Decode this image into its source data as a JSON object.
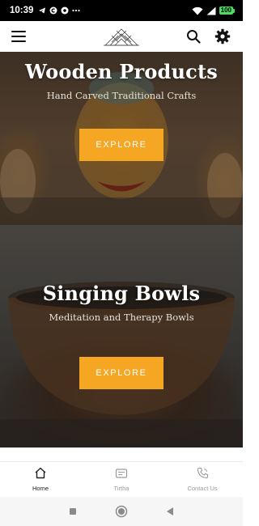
{
  "status_bar": {
    "time": "10:39",
    "battery": "100",
    "icons": [
      "telegram-icon",
      "circle-c-icon",
      "shield-icon",
      "more-dots-icon",
      "wifi-icon",
      "signal-icon",
      "battery-icon"
    ]
  },
  "app_bar": {
    "icons": [
      "menu-icon",
      "logo",
      "search-icon",
      "gear-icon"
    ]
  },
  "banners": [
    {
      "title": "Wooden Products",
      "subtitle": "Hand Carved Traditional Crafts",
      "button": "EXPLORE"
    },
    {
      "title": "Singing Bowls",
      "subtitle": "Meditation and Therapy Bowls",
      "button": "EXPLORE"
    }
  ],
  "bottom_nav": {
    "items": [
      {
        "label": "Home",
        "icon": "home-icon",
        "active": true
      },
      {
        "label": "Tirtha",
        "icon": "card-icon",
        "active": false
      },
      {
        "label": "Contact Us",
        "icon": "phone-icon",
        "active": false
      }
    ]
  },
  "system_nav": {
    "icons": [
      "recents-icon",
      "home-circle-icon",
      "back-icon"
    ]
  },
  "colors": {
    "accent": "#f5a623",
    "status_bar": "#000000",
    "app_bar": "#ffffff"
  }
}
